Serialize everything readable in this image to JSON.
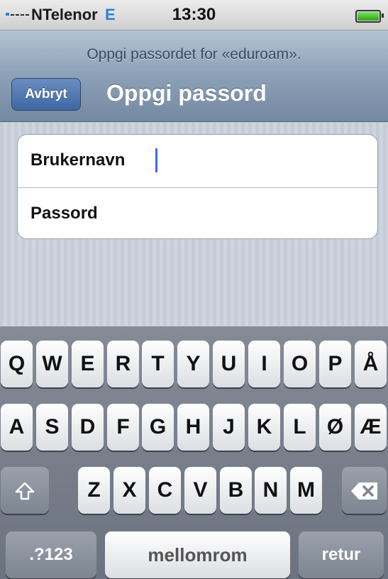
{
  "status_bar": {
    "carrier": "NTelenor",
    "network": "E",
    "time": "13:30"
  },
  "nav": {
    "prompt": "Oppgi passordet for «eduroam».",
    "cancel_label": "Avbryt",
    "title": "Oppgi passord"
  },
  "form": {
    "username_label": "Brukernavn",
    "password_label": "Passord"
  },
  "keyboard": {
    "row1": [
      "Q",
      "W",
      "E",
      "R",
      "T",
      "Y",
      "U",
      "I",
      "O",
      "P",
      "Å"
    ],
    "row2": [
      "A",
      "S",
      "D",
      "F",
      "G",
      "H",
      "J",
      "K",
      "L",
      "Ø",
      "Æ"
    ],
    "row3": [
      "Z",
      "X",
      "C",
      "V",
      "B",
      "N",
      "M"
    ],
    "shift_icon": "shift-arrow-icon",
    "delete_icon": "backspace-icon",
    "numbers_label": ".?123",
    "space_label": "mellomrom",
    "return_label": "retur"
  }
}
